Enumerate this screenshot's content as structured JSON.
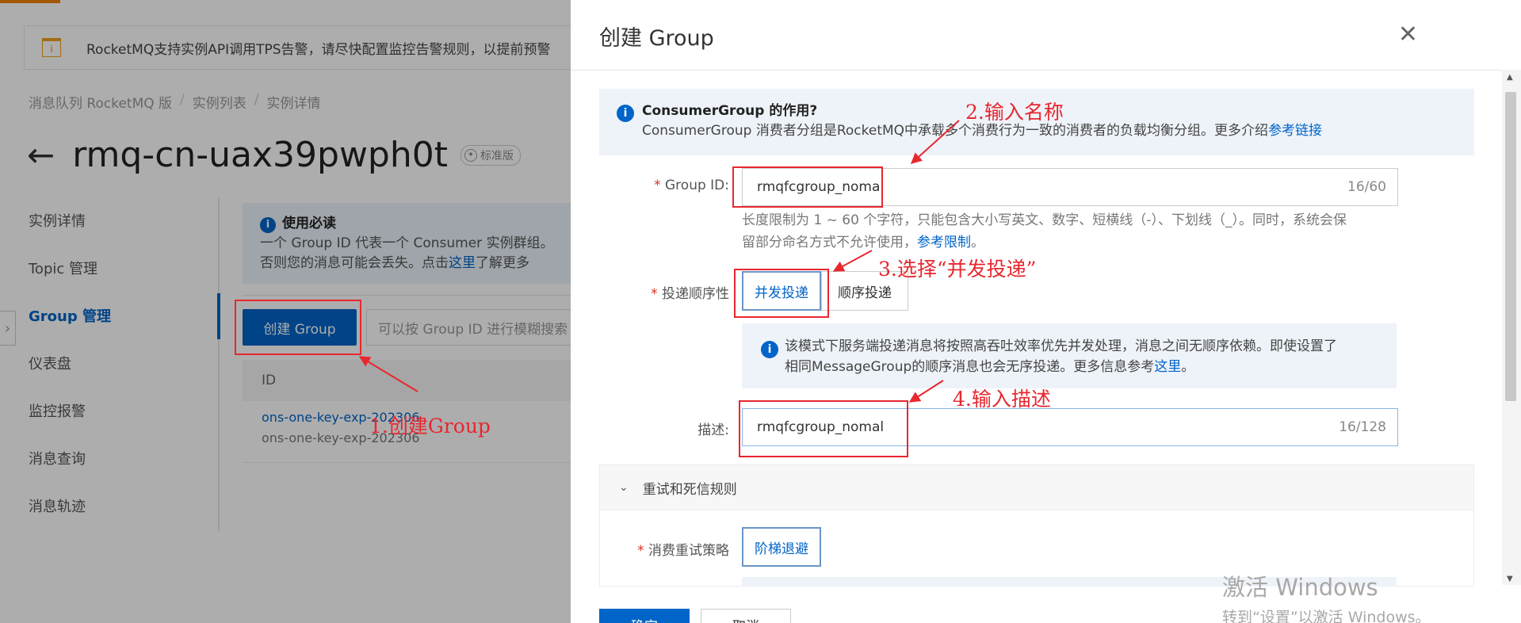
{
  "background": {
    "notice_icon": "alert-icon",
    "notice_text": "RocketMQ支持实例API调用TPS告警，请尽快配置监控告警规则，以提前预警",
    "breadcrumb": [
      "消息队列 RocketMQ 版",
      "实例列表",
      "实例详情"
    ],
    "instance_title": "rmq-cn-uax39pwph0t",
    "edition_badge": "标准版",
    "sidebar": [
      "实例详情",
      "Topic 管理",
      "Group 管理",
      "仪表盘",
      "监控报警",
      "消息查询",
      "消息轨迹"
    ],
    "sidebar_active": "Group 管理",
    "tip_title": "使用必读",
    "tip_line1": "一个 Group ID 代表一个 Consumer 实例群组。",
    "tip_line2_pre": "否则您的消息可能会丢失。点击",
    "tip_link": "这里",
    "tip_line2_post": "了解更多",
    "create_button": "创建 Group",
    "search_placeholder": "可以按 Group ID 进行模糊搜索",
    "table_header": "ID",
    "row_line1": "ons-one-key-exp-202306",
    "row_line2": "ons-one-key-exp-202306"
  },
  "drawer": {
    "title": "创建 Group",
    "close_icon": "close-icon",
    "info_title": "ConsumerGroup 的作用?",
    "info_text": "ConsumerGroup 消费者分组是RocketMQ中承载多个消费行为一致的消费者的负载均衡分组。更多介绍",
    "info_link": "参考链接",
    "group_id_label": "Group ID:",
    "group_id_value": "rmqfcgroup_nomal",
    "group_id_count": "16/60",
    "help_line1": "长度限制为 1 ~ 60 个字符，只能包含大小写英文、数字、短横线（-）、下划线（_）。同时，系统会保",
    "help_line2_pre": "留部分命名方式不允许使用，",
    "help_link": "参考限制",
    "help_line2_post": "。",
    "delivery_label": "投递顺序性",
    "delivery_options": [
      "并发投递",
      "顺序投递"
    ],
    "delivery_selected": "并发投递",
    "note_line1": "该模式下服务端投递消息将按照高吞吐效率优先并发处理，消息之间无顺序依赖。即使设置了",
    "note_line2_pre": "相同MessageGroup的顺序消息也会无序投递。更多信息参考",
    "note_link": "这里",
    "note_line2_post": "。",
    "desc_label": "描述:",
    "desc_value": "rmqfcgroup_nomal",
    "desc_count": "16/128",
    "section_title": "重试和死信规则",
    "retry_label": "消费重试策略",
    "retry_value": "阶梯退避",
    "footer_ok": "确定",
    "footer_cancel": "取消"
  },
  "annotations": {
    "step1": "1.创建Group",
    "step2": "2.输入名称",
    "step3": "3.选择“并发投递”",
    "step4": "4.输入描述",
    "color": "#e8272f"
  },
  "watermark": {
    "line1": "激活 Windows",
    "line2": "转到“设置”以激活 Windows。"
  }
}
